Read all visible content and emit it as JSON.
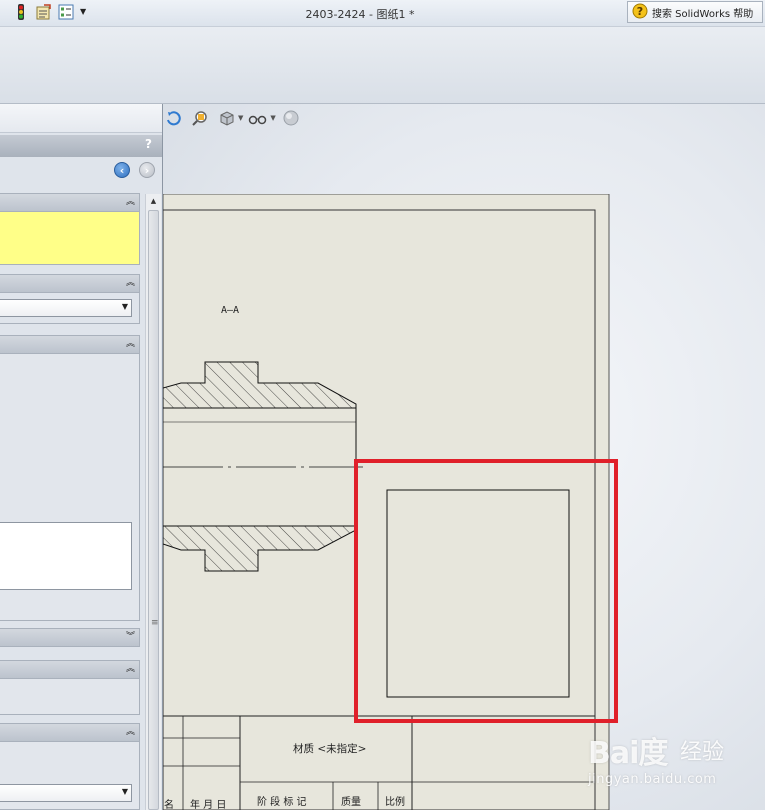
{
  "window": {
    "title": "2403-2424 - 图纸1 *",
    "help_search": "搜索 SolidWorks 帮助"
  },
  "quick_access": {
    "icons": [
      "traffic-light-icon",
      "file-properties-icon",
      "options-list-icon",
      "dropdown-arrow-icon"
    ]
  },
  "hud_toolbar": {
    "icons": [
      "rotate-view-icon",
      "zoom-to-area-icon",
      "display-style-icon",
      "hide-show-items-icon",
      "apply-scene-icon"
    ]
  },
  "property_manager": {
    "help_glyph": "?",
    "groups": [
      {
        "id": "message",
        "collapsed": false
      },
      {
        "id": "view-selection",
        "collapsed": false
      },
      {
        "id": "options",
        "collapsed": false
      },
      {
        "id": "section-a",
        "collapsed": true
      },
      {
        "id": "section-b",
        "collapsed": false
      },
      {
        "id": "section-c",
        "collapsed": false
      }
    ]
  },
  "drawing": {
    "section_label": "A—A",
    "title_block": {
      "material": "材质 <未指定>",
      "col_stage_mark": "阶 段 标 记",
      "col_mass": "质量",
      "col_scale": "比例",
      "col_date": "年 月 日",
      "col_name_fragment": "名"
    }
  },
  "watermark": {
    "logo": "Bai度",
    "sub": "经验",
    "url": "jingyan.baidu.com"
  },
  "colors": {
    "highlight_box": "#e0202a",
    "sheet_paper": "#e7e6dc",
    "message_box": "#ffff88"
  }
}
